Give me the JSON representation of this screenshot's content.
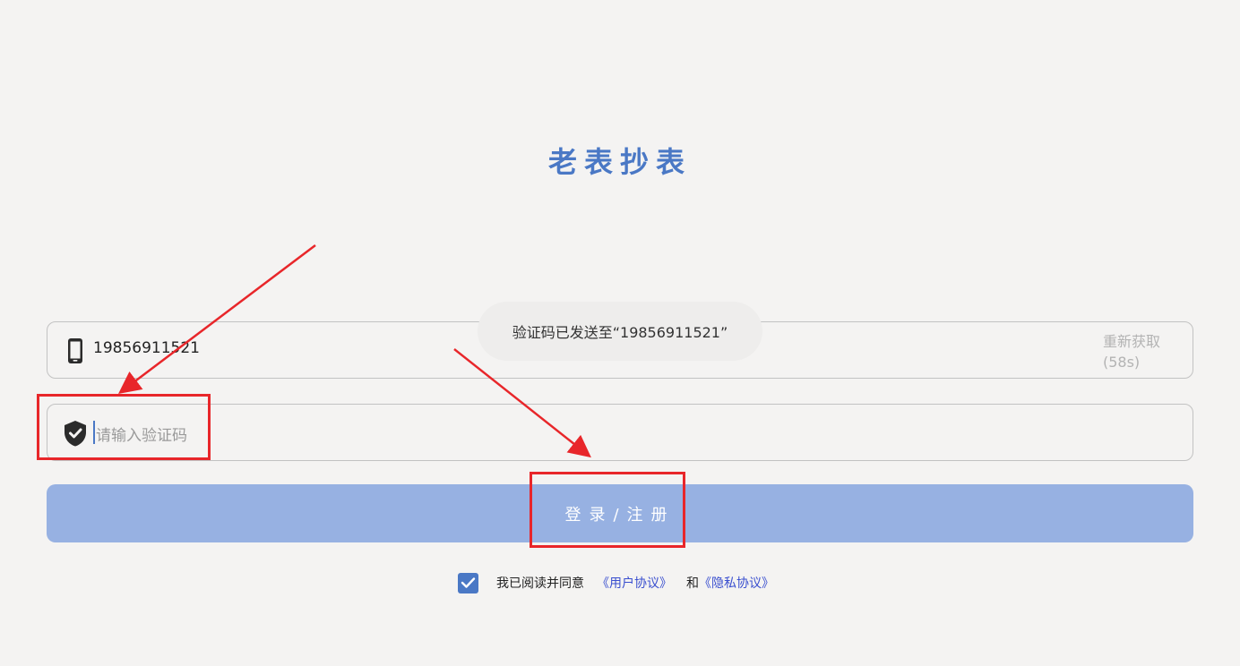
{
  "app": {
    "title": "老表抄表"
  },
  "phone_field": {
    "value": "19856911521",
    "resend_label": "重新获取",
    "countdown": "(58s)"
  },
  "code_field": {
    "placeholder": "请输入验证码"
  },
  "toast": {
    "message": "验证码已发送至“19856911521”"
  },
  "login_button": {
    "label": "登录/注册"
  },
  "agreement": {
    "checked": true,
    "prefix": "我已阅读并同意",
    "user_agreement": "《用户协议》",
    "conjunction": "和",
    "privacy_policy": "《隐私协议》"
  },
  "colors": {
    "accent": "#4a78c5",
    "button": "#97b1e2",
    "annotation": "#e8262a",
    "background": "#f4f3f2"
  },
  "icons": {
    "phone": "phone-icon",
    "shield": "shield-check-icon",
    "check": "check-icon"
  }
}
